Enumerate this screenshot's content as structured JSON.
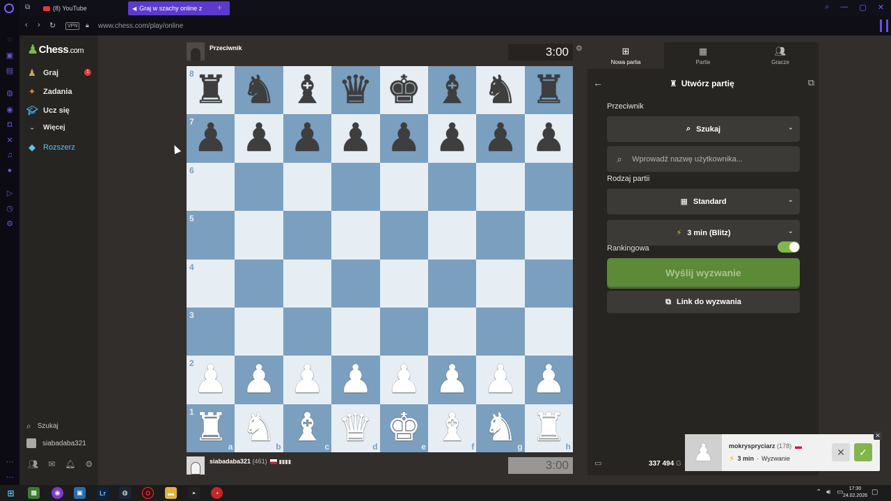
{
  "browser": {
    "tabs": [
      {
        "label": "(8) YouTube"
      },
      {
        "label": "Graj w szachy online z"
      }
    ],
    "url": "www.chess.com/play/online",
    "vpn_label": "VPN"
  },
  "nav": {
    "logo_main": "Chess",
    "logo_suffix": ".com",
    "items": [
      {
        "label": "Graj",
        "icon": "play-pawn-icon"
      },
      {
        "label": "Zadania",
        "icon": "puzzle-icon"
      },
      {
        "label": "Ucz się",
        "icon": "learn-icon"
      },
      {
        "label": "Więcej",
        "icon": "chevron-down-icon"
      },
      {
        "label": "Rozszerz",
        "icon": "diamond-icon"
      }
    ],
    "play_badge": "1",
    "search_label": "Szukaj",
    "username": "siabadaba321"
  },
  "game": {
    "opponent": {
      "name": "Przeciwnik"
    },
    "me": {
      "name": "siabadaba321",
      "rating": "(461)",
      "flag": "PL"
    },
    "top_clock": "3:00",
    "bottom_clock": "3:00",
    "board": {
      "ranks": [
        "8",
        "7",
        "6",
        "5",
        "4",
        "3",
        "2",
        "1"
      ],
      "files": [
        "a",
        "b",
        "c",
        "d",
        "e",
        "f",
        "g",
        "h"
      ],
      "position": [
        [
          "br",
          "bn",
          "bb",
          "bq",
          "bk",
          "bb",
          "bn",
          "br"
        ],
        [
          "bp",
          "bp",
          "bp",
          "bp",
          "bp",
          "bp",
          "bp",
          "bp"
        ],
        [
          "",
          "",
          "",
          "",
          "",
          "",
          "",
          ""
        ],
        [
          "",
          "",
          "",
          "",
          "",
          "",
          "",
          ""
        ],
        [
          "",
          "",
          "",
          "",
          "",
          "",
          "",
          ""
        ],
        [
          "",
          "",
          "",
          "",
          "",
          "",
          "",
          ""
        ],
        [
          "wp",
          "wp",
          "wp",
          "wp",
          "wp",
          "wp",
          "wp",
          "wp"
        ],
        [
          "wr",
          "wn",
          "wb",
          "wq",
          "wk",
          "wb",
          "wn",
          "wr"
        ]
      ]
    }
  },
  "panel": {
    "tabs": [
      {
        "label": "Nowa partia"
      },
      {
        "label": "Partie"
      },
      {
        "label": "Gracze"
      }
    ],
    "title": "Utwórz partię",
    "opponent_label": "Przeciwnik",
    "opponent_value": "Szukaj",
    "username_placeholder": "Wprowadź nazwę użytkownika...",
    "game_type_label": "Rodzaj partii",
    "game_type_value": "Standard",
    "time_value": "3 min (Blitz)",
    "rated_label": "Rankingowa",
    "rated_on": true,
    "send_challenge": "Wyślij wyzwanie",
    "challenge_link": "Link do wyzwania",
    "online_count": "337 494",
    "online_suffix": "G"
  },
  "notification": {
    "name": "mokryspryciarz",
    "rating": "(178)",
    "time": "3 min",
    "sep": " · ",
    "kind": "Wyzwanie"
  },
  "taskbar": {
    "time": "17:30",
    "date": "24.02.2026"
  }
}
